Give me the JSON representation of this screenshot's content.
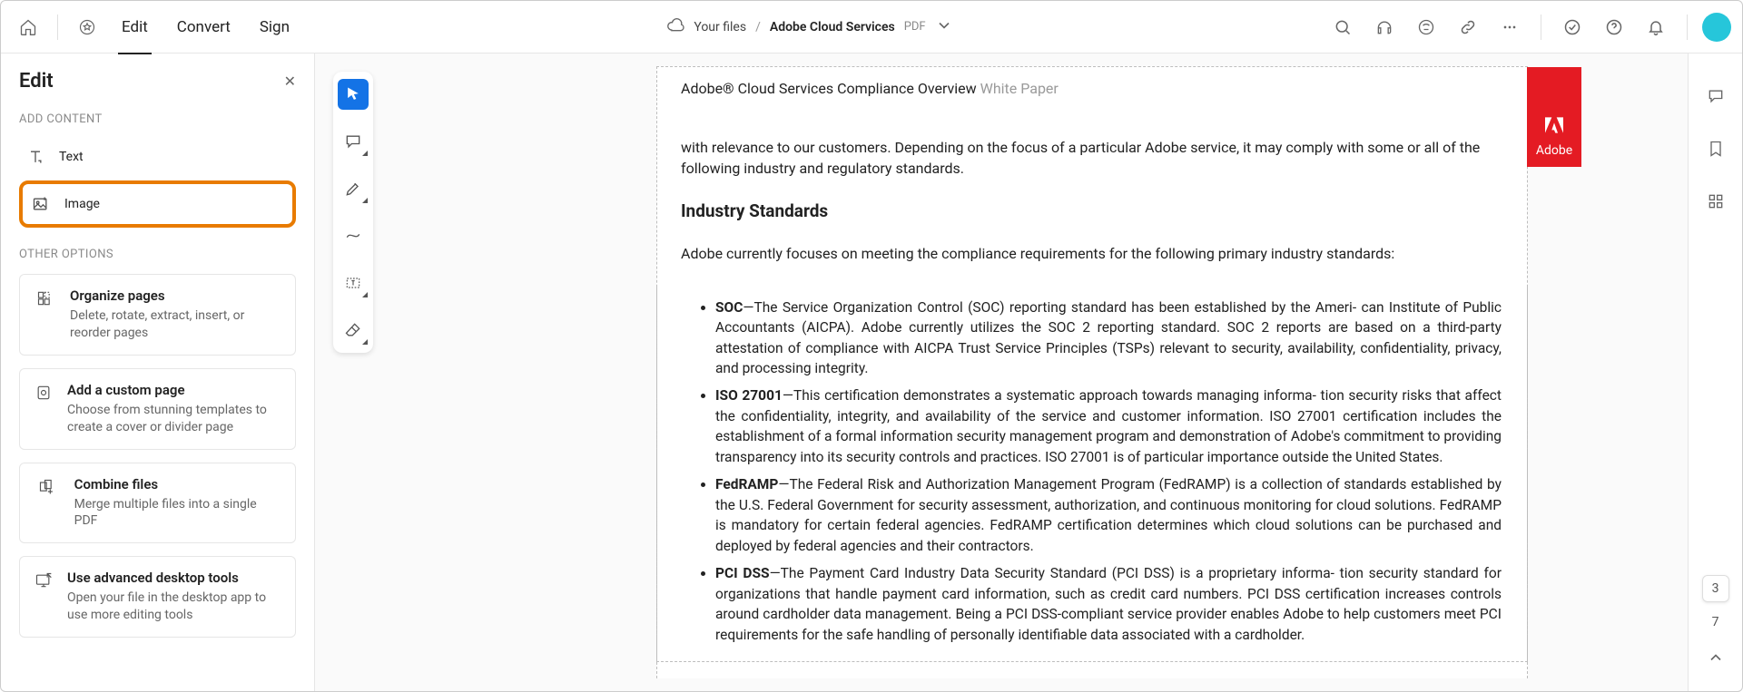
{
  "topbar": {
    "tabs": [
      "Edit",
      "Convert",
      "Sign"
    ],
    "active_tab": 0,
    "breadcrumb": {
      "root": "Your files",
      "current": "Adobe Cloud Services",
      "ext": "PDF"
    }
  },
  "edit_panel": {
    "title": "Edit",
    "sections": {
      "add_content": {
        "label": "ADD CONTENT",
        "items": [
          {
            "label": "Text",
            "icon": "text-icon",
            "highlighted": false
          },
          {
            "label": "Image",
            "icon": "image-icon",
            "highlighted": true
          }
        ]
      },
      "other_options": {
        "label": "OTHER OPTIONS",
        "cards": [
          {
            "title": "Organize pages",
            "desc": "Delete, rotate, extract, insert, or reorder pages",
            "icon": "organize-icon"
          },
          {
            "title": "Add a custom page",
            "desc": "Choose from stunning templates to create a cover or divider page",
            "icon": "custompage-icon"
          },
          {
            "title": "Combine files",
            "desc": "Merge multiple files into a single PDF",
            "icon": "combine-icon"
          },
          {
            "title": "Use advanced desktop tools",
            "desc": "Open your file in the desktop app to use more editing tools",
            "icon": "desktop-icon"
          }
        ]
      }
    }
  },
  "tools": [
    {
      "name": "select-tool",
      "active": true
    },
    {
      "name": "comment-tool",
      "active": false
    },
    {
      "name": "highlight-tool",
      "active": false
    },
    {
      "name": "draw-tool",
      "active": false
    },
    {
      "name": "textbox-tool",
      "active": false
    },
    {
      "name": "erase-tool",
      "active": false
    }
  ],
  "document": {
    "header_title": "Adobe® Cloud Services Compliance Overview ",
    "header_tag": "White Paper",
    "intro_para": "with relevance to our customers. Depending on the focus of a particular Adobe service, it may comply with some or all of the following industry and regulatory standards.",
    "section_heading": "Industry Standards",
    "section_para": "Adobe currently focuses on meeting the compliance requirements for the following primary industry standards:",
    "bullets": [
      {
        "term": "SOC",
        "text": "—The Service Organization Control (SOC) reporting standard has been established by the Ameri- can Institute of Public Accountants (AICPA). Adobe currently utilizes the SOC 2 reporting standard. SOC 2 reports are based on a third-party attestation of compliance with AICPA Trust Service Principles (TSPs) relevant to security, availability, confidentiality, privacy, and processing integrity."
      },
      {
        "term": "ISO 27001",
        "text": "—This certification demonstrates a systematic approach towards managing informa- tion security risks that affect the confidentiality, integrity, and availability of the service and customer information. ISO 27001 certification includes the establishment of a formal information security management program and demonstration of Adobe's commitment to providing transparency into its security controls and practices. ISO 27001 is of particular importance   outside the United States."
      },
      {
        "term": "FedRAMP",
        "text": "—The Federal Risk and Authorization Management Program (FedRAMP) is a collection of standards established by the U.S. Federal Government for security assessment, authorization, and continuous monitoring for cloud solutions. FedRAMP is mandatory for certain federal agencies. FedRAMP certification determines which cloud solutions can be purchased and deployed by federal agencies and their contractors."
      },
      {
        "term": "PCI DSS",
        "text": "—The Payment Card Industry Data Security Standard (PCI DSS) is a proprietary informa- tion security standard for organizations that handle payment card information, such as credit card numbers. PCI DSS certification increases controls around cardholder data management. Being a PCI DSS-compliant service provider enables Adobe to help customers meet PCI requirements for the safe handling of personally identifiable data associated with a cardholder."
      }
    ],
    "badge_label": "Adobe"
  },
  "right_rail_page": {
    "current": "3",
    "total": "7"
  }
}
